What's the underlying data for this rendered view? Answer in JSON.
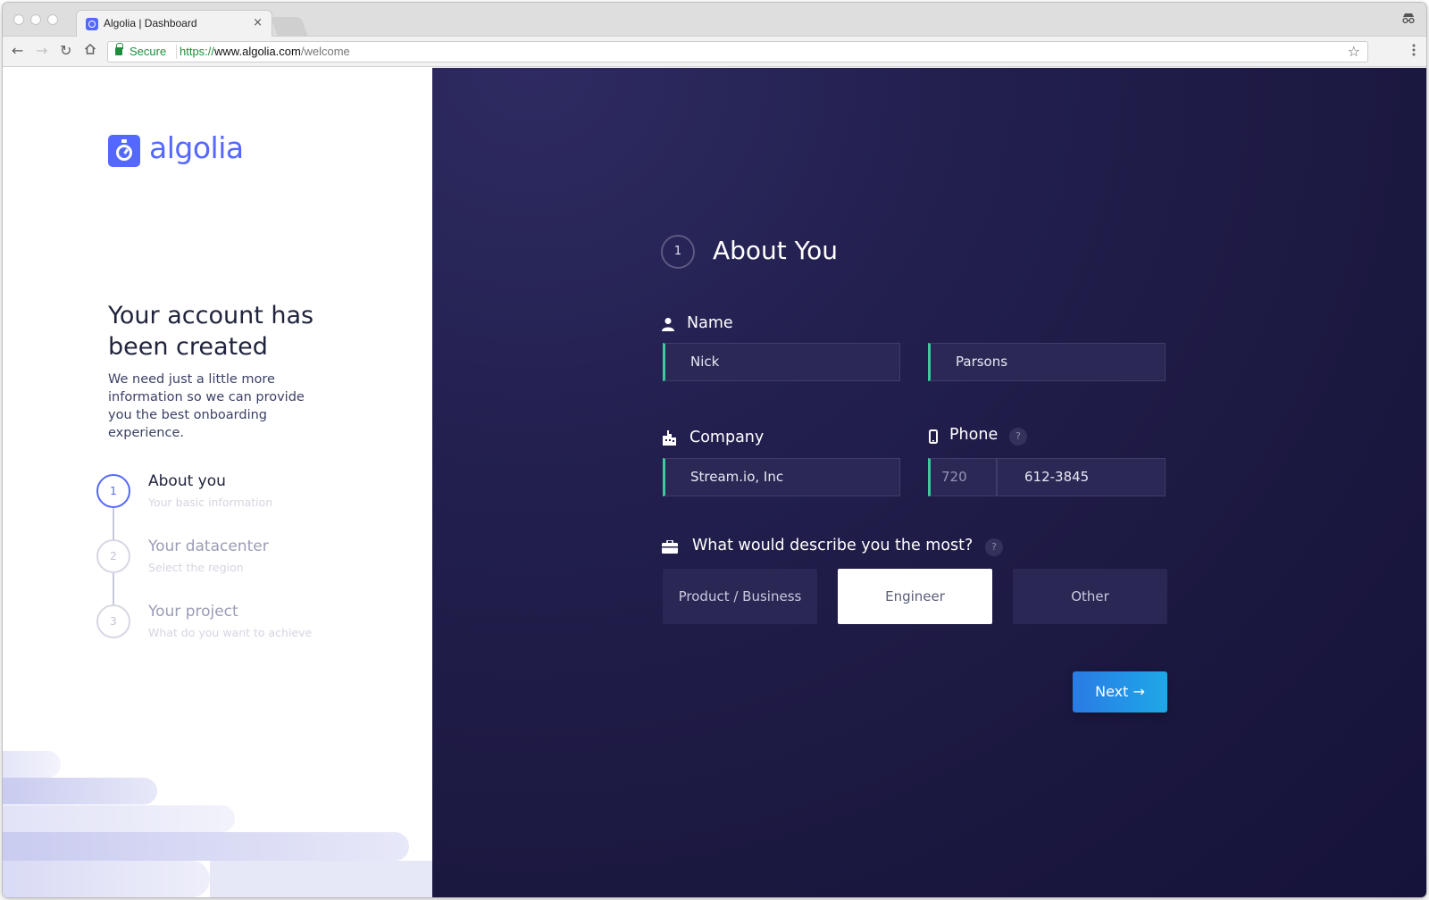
{
  "browser": {
    "tab_title": "Algolia | Dashboard",
    "tab_close": "×",
    "secure_label": "Secure",
    "url_scheme": "https://",
    "url_host": "www.algolia.com",
    "url_path": "/welcome",
    "icons": [
      "back-arrow-icon",
      "forward-arrow-icon",
      "reload-icon",
      "home-icon",
      "lock-icon",
      "star-icon",
      "kebab-menu-icon",
      "incognito-icon"
    ]
  },
  "brand": {
    "name": "algolia",
    "color": "#5468ff"
  },
  "intro": {
    "headline": "Your account has been created",
    "description": "We need just a little more information so we can provide you the best onboarding experience."
  },
  "steps": [
    {
      "number": "1",
      "title": "About you",
      "subtitle": "Your basic information",
      "active": true
    },
    {
      "number": "2",
      "title": "Your datacenter",
      "subtitle": "Select the region",
      "active": false
    },
    {
      "number": "3",
      "title": "Your project",
      "subtitle": "What do you want to achieve",
      "active": false
    }
  ],
  "form": {
    "step_number": "1",
    "title": "About You",
    "name_label": "Name",
    "first_name": "Nick",
    "last_name": "Parsons",
    "company_label": "Company",
    "company": "Stream.io, Inc",
    "phone_label": "Phone",
    "phone_area": "720",
    "phone_number": "612-3845",
    "role_label": "What would describe you the most?",
    "help_mark": "?",
    "roles": [
      "Product / Business",
      "Engineer",
      "Other"
    ],
    "selected_role": "Engineer",
    "next_label": "Next →",
    "accent_color": "#3ccb9f",
    "button_color": "#1ea8e8"
  }
}
